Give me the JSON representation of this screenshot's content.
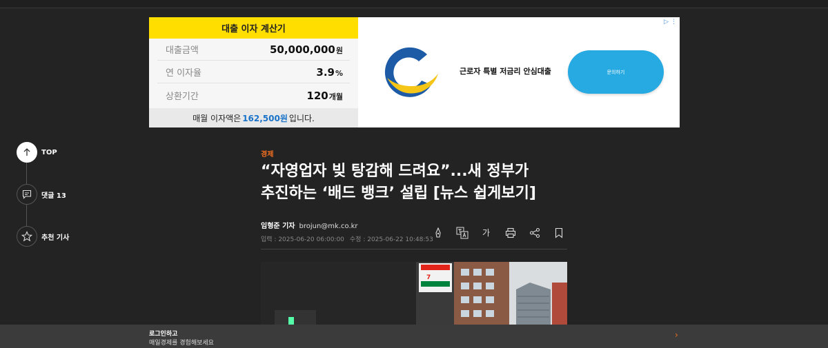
{
  "ad": {
    "calculator": {
      "title": "대출 이자 계산기",
      "rows": [
        {
          "label": "대출금액",
          "value": "50,000,000",
          "unit": "원"
        },
        {
          "label": "연 이자율",
          "value": "3.9",
          "unit": "%"
        },
        {
          "label": "상환기간",
          "value": "120",
          "unit": "개월"
        }
      ],
      "footer_prefix": "매월 이자액은",
      "footer_amount": "162,500원",
      "footer_suffix": "입니다."
    },
    "product_text": "근로자 특별 저금리 안심대출",
    "cta_label": "문의하기",
    "logo_colors": [
      "#1d5ba6",
      "#f5c518"
    ],
    "cta_color": "#27a9e1"
  },
  "rail": {
    "top_label": "TOP",
    "comments_label": "댓글 13",
    "recommended_label": "추천 기사"
  },
  "article": {
    "category": "경제",
    "headline_line1": "“자영업자 빚 탕감해 드려요”...새 정부가",
    "headline_line2": "추진하는 ‘배드 뱅크’ 설립 [뉴스 쉽게보기]",
    "reporter": "임형준 기자",
    "email": "brojun@mk.co.kr",
    "published": "입력 : 2025-06-20 06:00:00",
    "modified": "수정 : 2025-06-22 10:48:53",
    "font_size_tool": "가"
  },
  "login_bar": {
    "title": "로그인하고",
    "subtitle": "매일경제를 경험해보세요"
  },
  "colors": {
    "accent": "#f36f21",
    "background": "#232323",
    "calculator_header": "#ffde00"
  }
}
